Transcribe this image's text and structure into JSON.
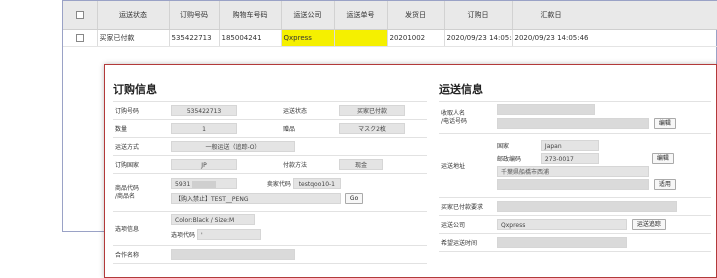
{
  "orders_table": {
    "headers": [
      "运送状态",
      "订购号码",
      "购物车号码",
      "运送公司",
      "运送单号",
      "发货日",
      "订购日",
      "汇款日"
    ],
    "row": [
      "买家已付款",
      "535422713",
      "185004241",
      "Qxpress",
      "",
      "20201002",
      "2020/09/23 14:05:43",
      "2020/09/23 14:05:46"
    ]
  },
  "order_info": {
    "title": "订购信息",
    "order_no_label": "订购号码",
    "order_no": "535422713",
    "ship_status_label": "运送状态",
    "ship_status": "买家已付款",
    "qty_label": "数量",
    "qty": "1",
    "gift_label": "赠品",
    "gift": "マスク2枚",
    "ship_method_label": "运送方式",
    "ship_method": "一般运送（追踪-O）",
    "order_country_label": "订购国家",
    "order_country": "JP",
    "pay_method_label": "付款方法",
    "pay_method": "现金",
    "product_label": "商品代码\n/商品名",
    "product_code": "5931",
    "seller_code_label": "卖家代码",
    "seller_code": "testqoo10-1",
    "product_name": "【购入禁止】TEST__PENG",
    "go_button": "Go",
    "option_label": "选项信息",
    "option_value": "Color:Black / Size:M",
    "option_code_label": "选项代码",
    "option_code": "'",
    "partner_label": "合作名称"
  },
  "ship_info": {
    "title": "运送信息",
    "recipient_label": "收取人名\n/电话号码",
    "edit_button": "编辑",
    "address_label": "运送地址",
    "country_label": "国家",
    "country": "Japan",
    "zip_label": "邮政编码",
    "zip": "273-0017",
    "address_line": "千葉県船橋市西浦",
    "apply_button": "适用",
    "buyer_request_label": "买家已付款要求",
    "ship_company_label": "运送公司",
    "ship_company": "Qxpress",
    "track_button": "运送追踪",
    "hope_date_label": "希望运送时间"
  }
}
